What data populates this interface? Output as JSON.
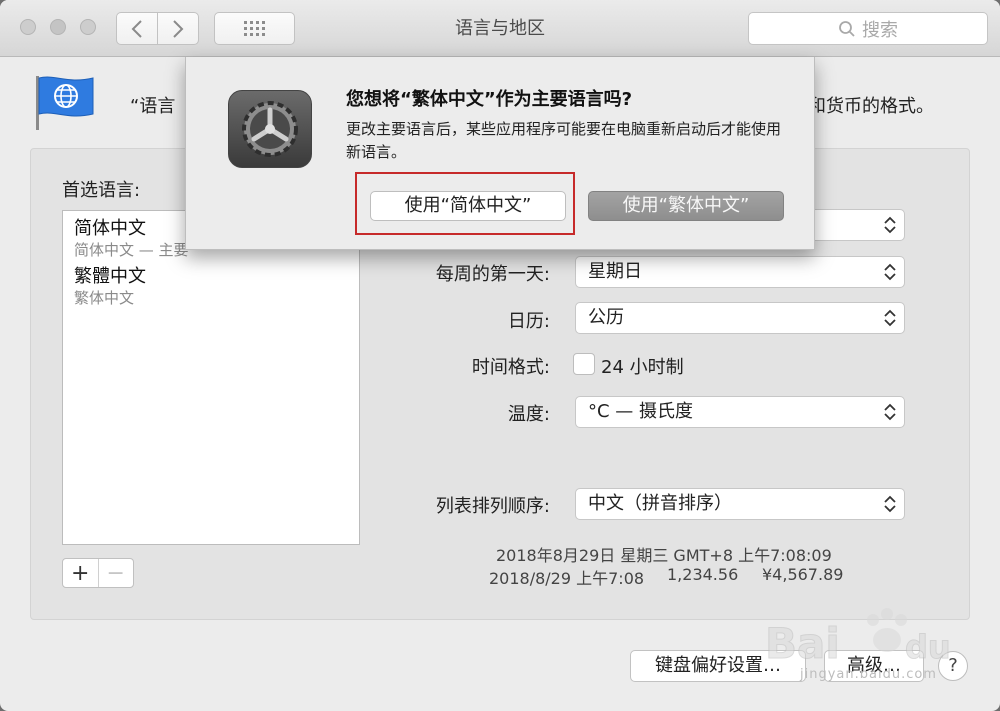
{
  "window": {
    "title": "语言与地区",
    "search_placeholder": "搜索"
  },
  "header": {
    "left_text": "“语言",
    "right_text": "和货币的格式。"
  },
  "languages": {
    "title": "首选语言:",
    "items": [
      {
        "name": "简体中文",
        "sub": "简体中文 — 主要"
      },
      {
        "name": "繁體中文",
        "sub": "繁体中文"
      }
    ],
    "add_label": "+",
    "remove_label": "−"
  },
  "settings": {
    "first_day_label": "每周的第一天:",
    "first_day_value": "星期日",
    "calendar_label": "日历:",
    "calendar_value": "公历",
    "time_format_label": "时间格式:",
    "time_format_option": "24 小时制",
    "temperature_label": "温度:",
    "temperature_value": "°C — 摄氏度",
    "sort_label": "列表排列顺序:",
    "sort_value": "中文（拼音排序）"
  },
  "sample": {
    "line1": "2018年8月29日 星期三 GMT+8 上午7:08:09",
    "line2_date": "2018/8/29 上午7:08",
    "line2_number": "1,234.56",
    "line2_currency": "¥4,567.89"
  },
  "footer": {
    "keyboard_button": "键盘偏好设置…",
    "advanced_button": "高级…",
    "help_label": "?"
  },
  "dialog": {
    "title": "您想将“繁体中文”作为主要语言吗?",
    "message": "更改主要语言后，某些应用程序可能要在电脑重新启动后才能使用新语言。",
    "use_simplified_button": "使用“简体中文”",
    "use_traditional_button": "使用“繁体中文”"
  },
  "watermark": {
    "brand": "Bai du 经验",
    "url": "jingyan.baidu.com"
  },
  "colors": {
    "highlight_border": "#c62a2a",
    "flag_blue": "#2f7be0"
  }
}
